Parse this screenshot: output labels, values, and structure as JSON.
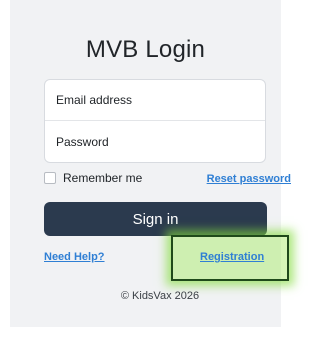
{
  "login": {
    "title": "MVB Login",
    "email_placeholder": "Email address",
    "password_placeholder": "Password",
    "remember_label": "Remember me",
    "reset_password_link": "Reset password",
    "signin_button": "Sign in",
    "need_help_link": "Need Help?",
    "registration_link": "Registration",
    "footer_text": "© KidsVax 2026"
  },
  "colors": {
    "signin_bg": "#2b3a4e",
    "link": "#2f7fd4",
    "highlight": "#8fdc4a"
  }
}
